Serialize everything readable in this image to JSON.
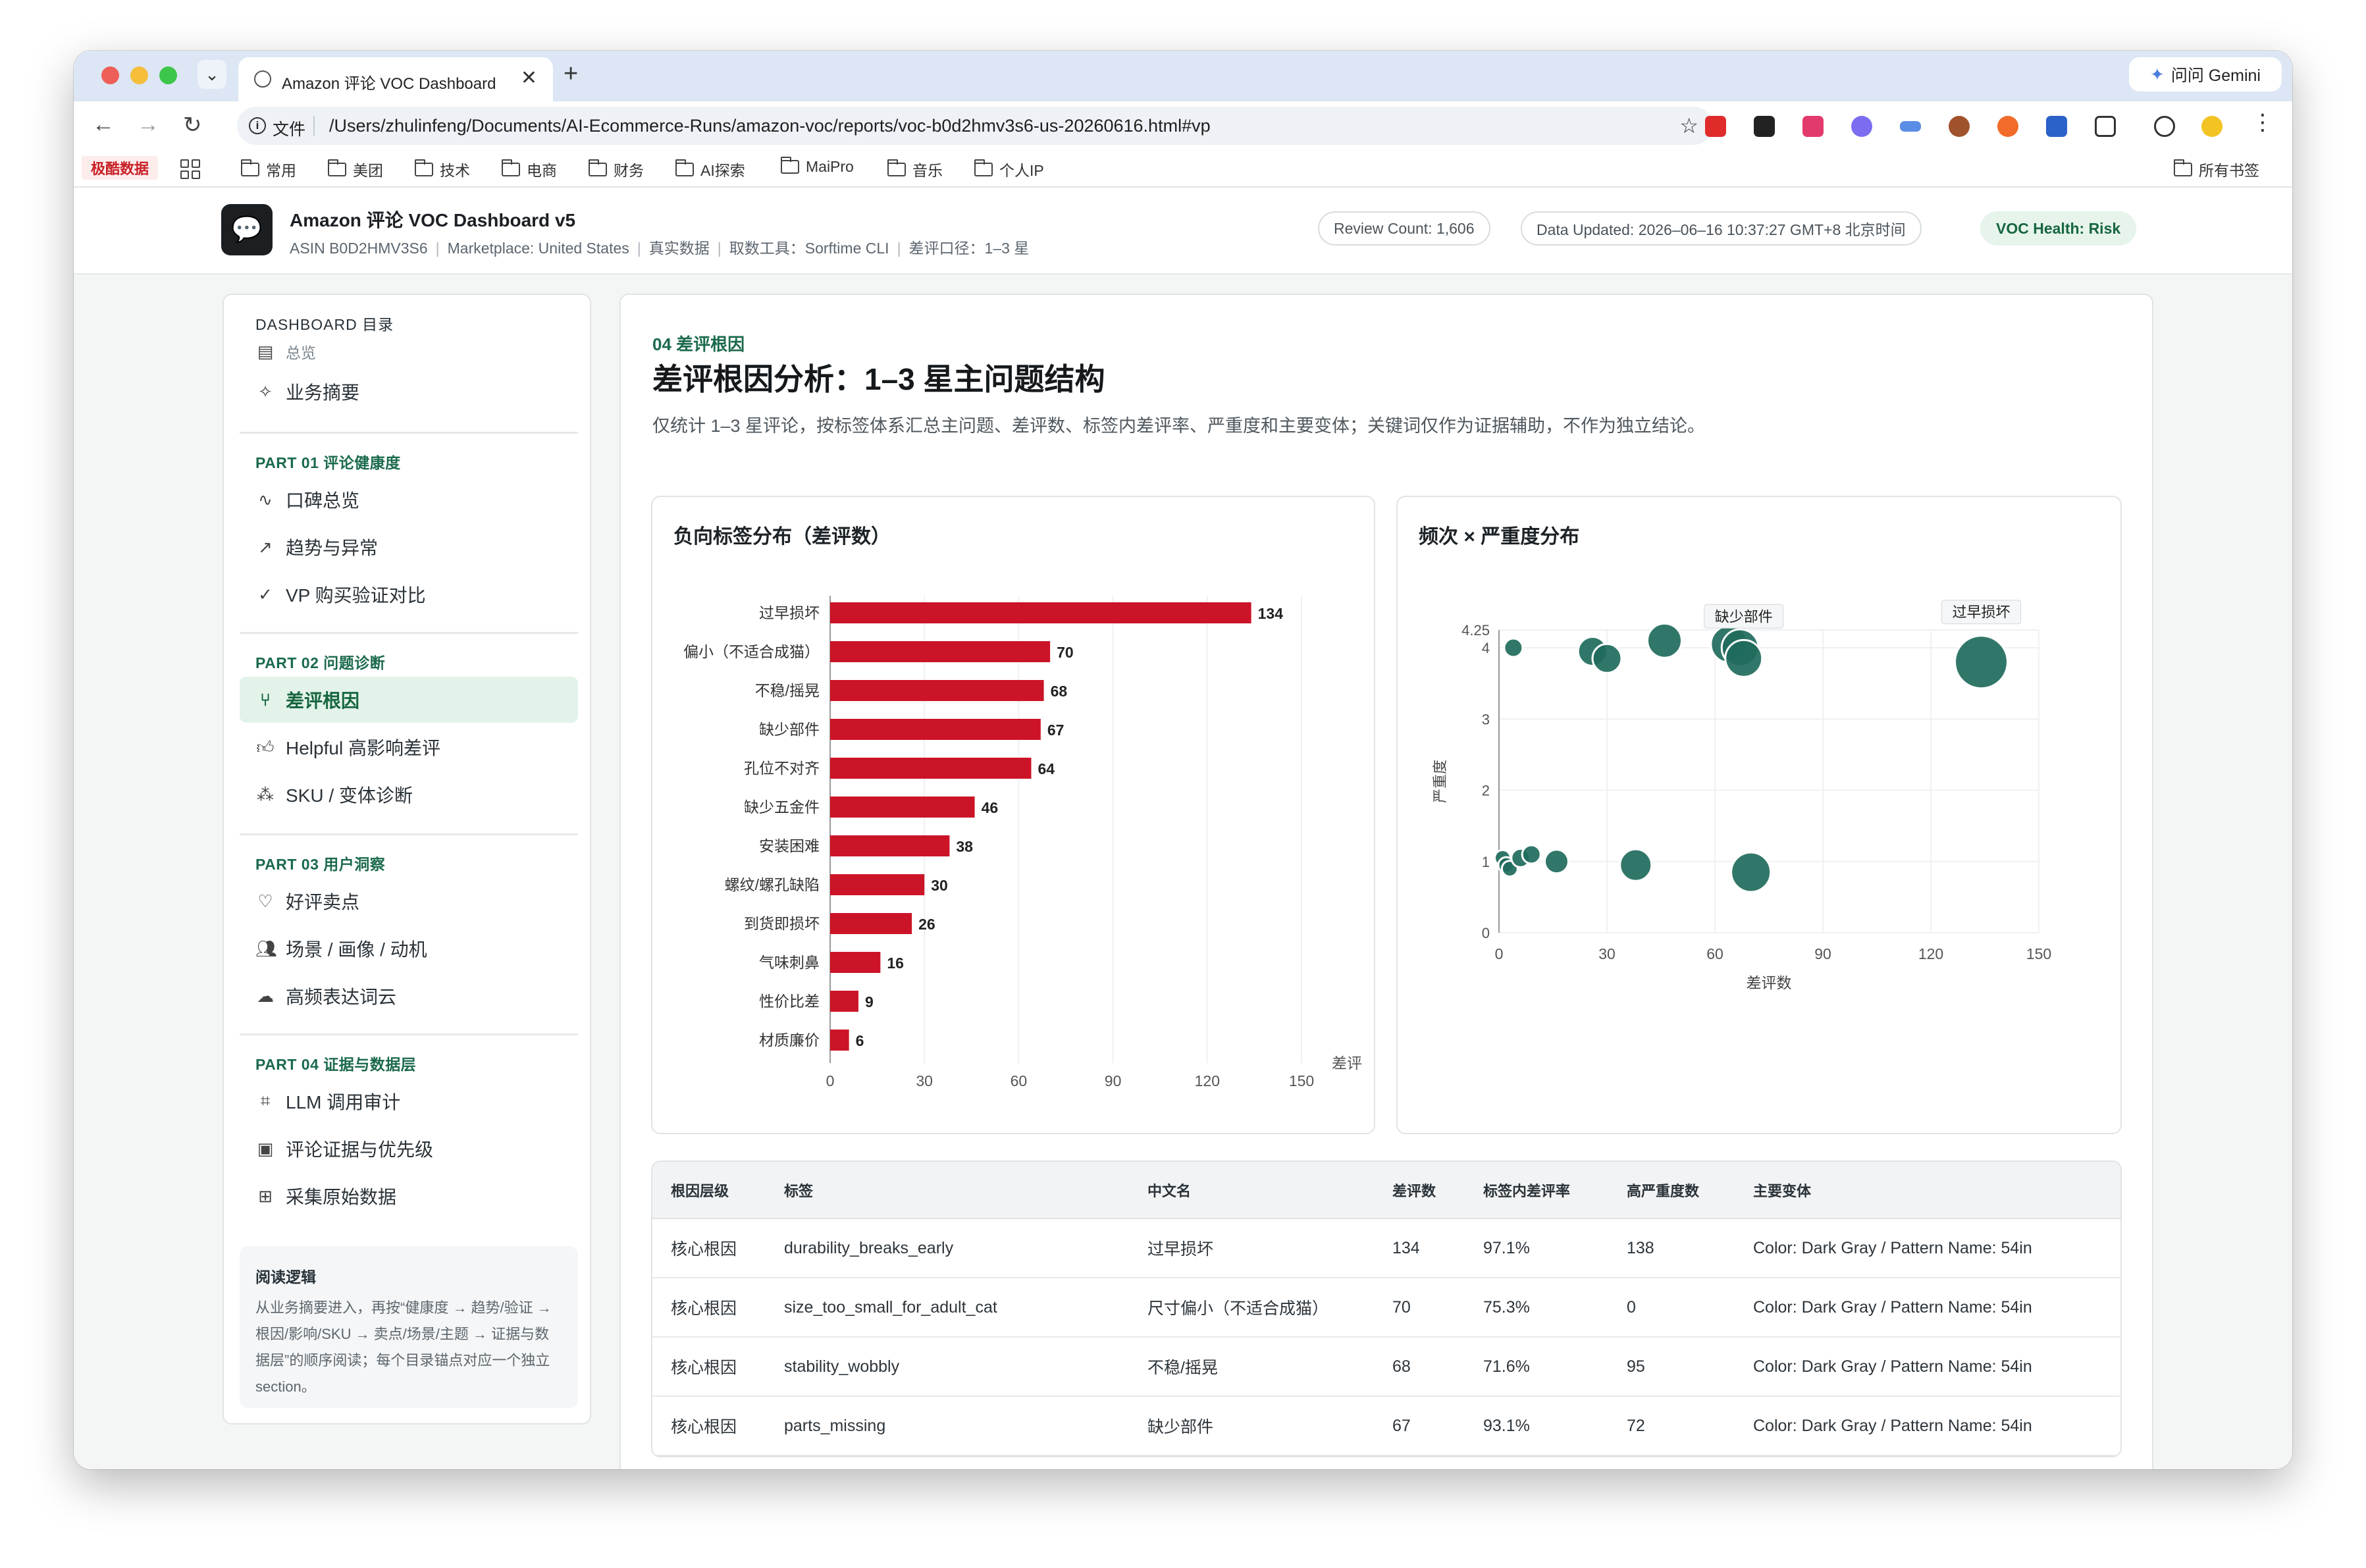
{
  "browser": {
    "tab_title": "Amazon 评论 VOC Dashboard",
    "gemini_label": "问问 Gemini",
    "address_label": "文件",
    "url": "/Users/zhulinfeng/Documents/AI-Ecommerce-Runs/amazon-voc/reports/voc-b0d2hmv3s6-us-20260616.html#vp",
    "bookmarks": [
      "常用",
      "美团",
      "技术",
      "电商",
      "财务",
      "AI探索",
      "MaiPro",
      "音乐",
      "个人IP"
    ],
    "bookmark_highlight": "极酷数据",
    "all_bookmarks": "所有书签"
  },
  "header": {
    "logo_icon": "chat-icon",
    "title": "Amazon 评论 VOC Dashboard v5",
    "meta": [
      "ASIN B0D2HMV3S6",
      "Marketplace: United States",
      "真实数据",
      "取数工具：Sorftime CLI",
      "差评口径：1–3 星"
    ],
    "review_count": "Review Count: 1,606",
    "data_updated": "Data Updated: 2026–06–16 10:37:27 GMT+8 北京时间",
    "health": "VOC Health: Risk",
    "health_color": "#17663f"
  },
  "sidebar": {
    "title": "DASHBOARD 目录",
    "top_items": [
      {
        "label": "总览",
        "icon": "document-icon"
      },
      {
        "label": "业务摘要",
        "icon": "sparkle-icon"
      }
    ],
    "parts": [
      {
        "title": "PART 01 评论健康度",
        "items": [
          {
            "label": "口碑总览",
            "icon": "pulse-icon"
          },
          {
            "label": "趋势与异常",
            "icon": "trend-icon"
          },
          {
            "label": "VP 购买验证对比",
            "icon": "check-circle-icon"
          }
        ]
      },
      {
        "title": "PART 02 问题诊断",
        "items": [
          {
            "label": "差评根因",
            "icon": "branch-icon",
            "active": true
          },
          {
            "label": "Helpful 高影响差评",
            "icon": "thumbs-up-icon"
          },
          {
            "label": "SKU / 变体诊断",
            "icon": "boxes-icon"
          }
        ]
      },
      {
        "title": "PART 03 用户洞察",
        "items": [
          {
            "label": "好评卖点",
            "icon": "heart-icon"
          },
          {
            "label": "场景 / 画像 / 动机",
            "icon": "users-icon"
          },
          {
            "label": "高频表达词云",
            "icon": "cloud-icon"
          }
        ]
      },
      {
        "title": "PART 04 证据与数据层",
        "items": [
          {
            "label": "LLM 调用审计",
            "icon": "scan-icon"
          },
          {
            "label": "评论证据与优先级",
            "icon": "clipboard-icon"
          },
          {
            "label": "采集原始数据",
            "icon": "table-icon"
          }
        ]
      }
    ],
    "reading_title": "阅读逻辑",
    "reading_body": "从业务摘要进入，再按“健康度 → 趋势/验证 → 根因/影响/SKU → 卖点/场景/主题 → 证据与数据层”的顺序阅读；每个目录锚点对应一个独立 section。"
  },
  "section": {
    "label": "04 差评根因",
    "title": "差评根因分析：1–3 星主问题结构",
    "desc": "仅统计 1–3 星评论，按标签体系汇总主问题、差评数、标签内差评率、严重度和主要变体；关键词仅作为证据辅助，不作为独立结论。"
  },
  "chart_data": [
    {
      "type": "bar",
      "orientation": "horizontal",
      "title": "负向标签分布（差评数）",
      "xlabel": "差评",
      "ylabel": "",
      "xlim": [
        0,
        150
      ],
      "xticks": [
        0,
        30,
        60,
        90,
        120,
        150
      ],
      "categories": [
        "过早损坏",
        "偏小（不适合成猫）",
        "不稳/摇晃",
        "缺少部件",
        "孔位不对齐",
        "缺少五金件",
        "安装困难",
        "螺纹/螺孔缺陷",
        "到货即损坏",
        "气味刺鼻",
        "性价比差",
        "材质廉价"
      ],
      "values": [
        134,
        70,
        68,
        67,
        64,
        46,
        38,
        30,
        26,
        16,
        9,
        6
      ],
      "bar_color": "#cc1428"
    },
    {
      "type": "scatter",
      "title": "频次 × 严重度分布",
      "xlabel": "差评数",
      "ylabel": "严重度",
      "xlim": [
        0,
        150
      ],
      "ylim": [
        0,
        4.25
      ],
      "xticks": [
        0,
        30,
        60,
        90,
        120,
        150
      ],
      "yticks": [
        0,
        1,
        2,
        3,
        4,
        4.25
      ],
      "point_color": "#1f6b5c",
      "points": [
        {
          "x": 4,
          "y": 4.0,
          "size": 14
        },
        {
          "x": 26,
          "y": 3.95,
          "size": 22
        },
        {
          "x": 30,
          "y": 3.85,
          "size": 22
        },
        {
          "x": 46,
          "y": 4.1,
          "size": 26
        },
        {
          "x": 64,
          "y": 4.05,
          "size": 28
        },
        {
          "x": 67,
          "y": 4.0,
          "size": 28
        },
        {
          "x": 68,
          "y": 3.85,
          "size": 28,
          "label": "缺少部件"
        },
        {
          "x": 134,
          "y": 3.8,
          "size": 40,
          "label": "过早损坏"
        },
        {
          "x": 1,
          "y": 1.05,
          "size": 12
        },
        {
          "x": 2,
          "y": 0.95,
          "size": 12
        },
        {
          "x": 3,
          "y": 0.9,
          "size": 12
        },
        {
          "x": 6,
          "y": 1.05,
          "size": 14
        },
        {
          "x": 9,
          "y": 1.1,
          "size": 14
        },
        {
          "x": 16,
          "y": 1.0,
          "size": 18
        },
        {
          "x": 38,
          "y": 0.95,
          "size": 24
        },
        {
          "x": 70,
          "y": 0.85,
          "size": 30
        }
      ]
    }
  ],
  "table": {
    "headers": [
      "根因层级",
      "标签",
      "中文名",
      "差评数",
      "标签内差评率",
      "高严重度数",
      "主要变体"
    ],
    "rows": [
      [
        "核心根因",
        "durability_breaks_early",
        "过早损坏",
        "134",
        "97.1%",
        "138",
        "Color: Dark Gray / Pattern Name: 54in"
      ],
      [
        "核心根因",
        "size_too_small_for_adult_cat",
        "尺寸偏小（不适合成猫）",
        "70",
        "75.3%",
        "0",
        "Color: Dark Gray / Pattern Name: 54in"
      ],
      [
        "核心根因",
        "stability_wobbly",
        "不稳/摇晃",
        "68",
        "71.6%",
        "95",
        "Color: Dark Gray / Pattern Name: 54in"
      ],
      [
        "核心根因",
        "parts_missing",
        "缺少部件",
        "67",
        "93.1%",
        "72",
        "Color: Dark Gray / Pattern Name: 54in"
      ]
    ]
  }
}
